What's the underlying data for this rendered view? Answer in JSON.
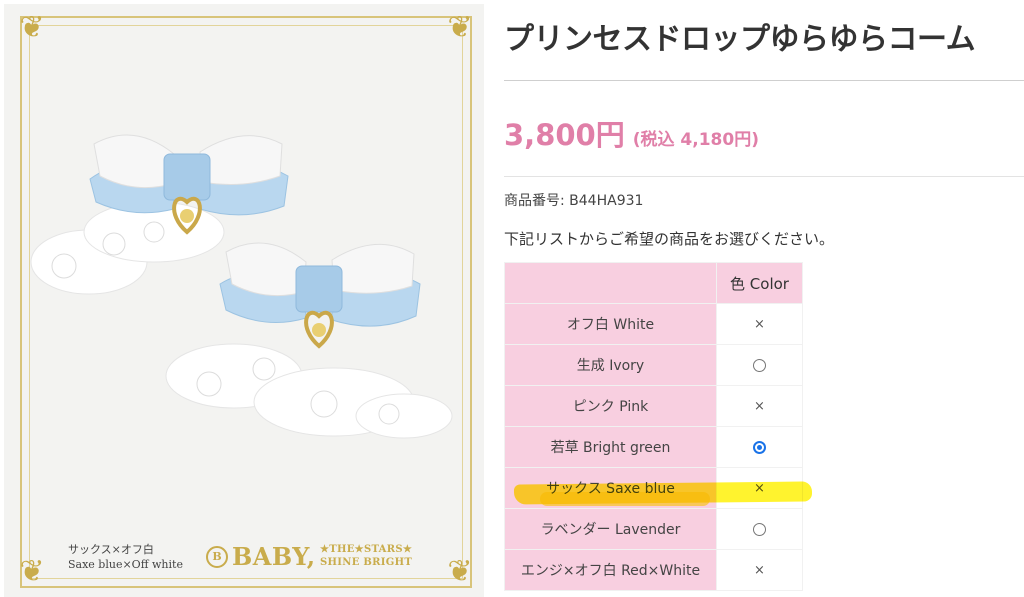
{
  "product": {
    "title": "プリンセスドロップゆらゆらコーム",
    "price": "3,800円",
    "price_tax": "(税込  4,180円)",
    "sku_label": "商品番号:",
    "sku_value": "B44HA931",
    "instruction": "下記リストからご希望の商品をお選びください。"
  },
  "image": {
    "caption_line1": "サックス×オフ白",
    "caption_line2": "Saxe blue×Off white",
    "brand_main": "BABY,",
    "brand_sub_line1": "★THE★STARS★",
    "brand_sub_line2": "SHINE BRIGHT",
    "brand_emblem_letter": "B"
  },
  "variant_table": {
    "header_choice": "色 Color",
    "rows": [
      {
        "label": "オフ白 White",
        "state": "soldout",
        "mark": "×"
      },
      {
        "label": "生成 Ivory",
        "state": "available"
      },
      {
        "label": "ピンク Pink",
        "state": "soldout",
        "mark": "×"
      },
      {
        "label": "若草 Bright green",
        "state": "selected"
      },
      {
        "label": "サックス Saxe blue",
        "state": "soldout",
        "mark": "×",
        "highlighted": true
      },
      {
        "label": "ラベンダー Lavender",
        "state": "available"
      },
      {
        "label": "エンジ×オフ白 Red×White",
        "state": "soldout",
        "mark": "×"
      }
    ]
  },
  "colors": {
    "price_pink": "#e07fa8",
    "table_pink": "#f8cfe0",
    "highlight_yellow": "#fff000",
    "frame_gold": "#c9ac4c",
    "bow_blue": "#b9d7ef"
  }
}
